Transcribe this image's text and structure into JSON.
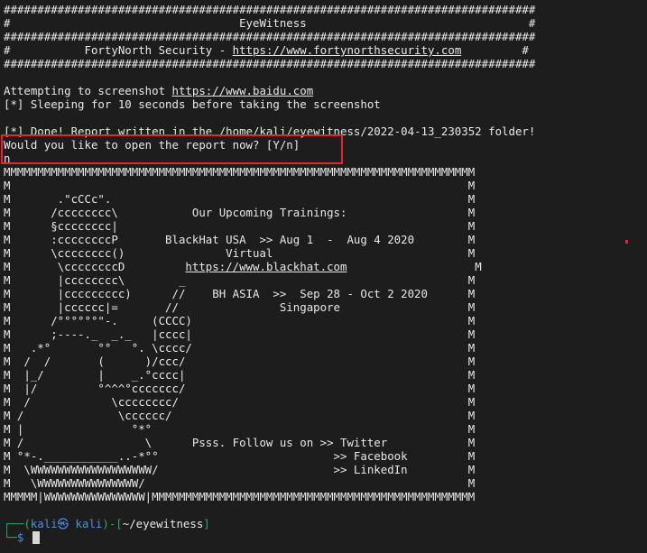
{
  "header": [
    "###############################################################################",
    "#                                  EyeWitness                                 #",
    "###############################################################################",
    "#           FortyNorth Security - ",
    "###############################################################################"
  ],
  "header_link": "https://www.fortynorthsecurity.com",
  "header_link_suffix": "         #",
  "output": {
    "attempt_prefix": "Attempting to screenshot ",
    "attempt_url": "https://www.baidu.com",
    "sleeping": "[*] Sleeping for 10 seconds before taking the screenshot",
    "done": "[*] Done! Report written in the /home/kali/eyewitness/2022-04-13_230352 folder!",
    "question": "Would you like to open the report now? [Y/n]",
    "answer": "n"
  },
  "banner": [
    "MMMMMMMMMMMMMMMMMMMMMMMMMMMMMMMMMMMMMMMMMMMMMMMMMMMMMMMMMMMMMMMMMMMMMM",
    "M                                                                    M",
    "M       .\"cCCc\".                                                     M",
    "M      /cccccccc\\           Our Upcoming Trainings:                  M",
    "M      §cccccccc|                                                    M",
    "M      :ccccccccP       BlackHat USA  >> Aug 1  -  Aug 4 2020        M",
    "M      \\cccccccc()               Virtual                             M",
    "M       \\ccccccccD         ",
    "M       |cccccccc\\        _                                          M",
    "M       |ccccccccc)      //    BH ASIA  >>  Sep 28 - Oct 2 2020      M",
    "M       |cccccc|=       //               Singapore                   M",
    "M      /°°°°°°\"-.     (CCCC)                                         M",
    "M      ;----._  _._   |cccc|                                         M",
    "M   .*°       °°   °. \\cccc/                                         M",
    "M  /  /       (      )/ccc/                                          M",
    "M  |_/        |    _.°cccc|                                          M",
    "M  |/         °^^^°ccccccc/                                          M",
    "M  /            \\cccccccc/                                           M",
    "M /              \\cccccc/                                            M",
    "M |                °*°                                               M",
    "M /                  \\      Psss. Follow us on >> Twitter            M",
    "M °*-.___________..-*°°                          >> Facebook         M",
    "M  \\WWWWWWWWWWWWWWWWWW/                          >> LinkedIn         M",
    "M   \\WWWWWWWWWWWWWWW/                                                M",
    "MMMMM|WWWWWWWWWWWWWWW|MMMMMMMMMMMMMMMMMMMMMMMMMMMMMMMMMMMMMMMMMMMMMMMM"
  ],
  "banner_link": "https://www.blackhat.com",
  "banner_link_suffix": "                   M",
  "prompt": {
    "corner_top": "┌──(",
    "user": "kali㉿ kali",
    "close": ")-[",
    "path": "~/eyewitness",
    "end": "]",
    "corner_bottom": "└─",
    "symbol": "$"
  },
  "colors": {
    "background": "#1d1d1d",
    "text": "#e8e8e8",
    "highlight_box": "#e0262e",
    "prompt_green": "#3aa55a",
    "prompt_blue": "#4c8fe6"
  }
}
